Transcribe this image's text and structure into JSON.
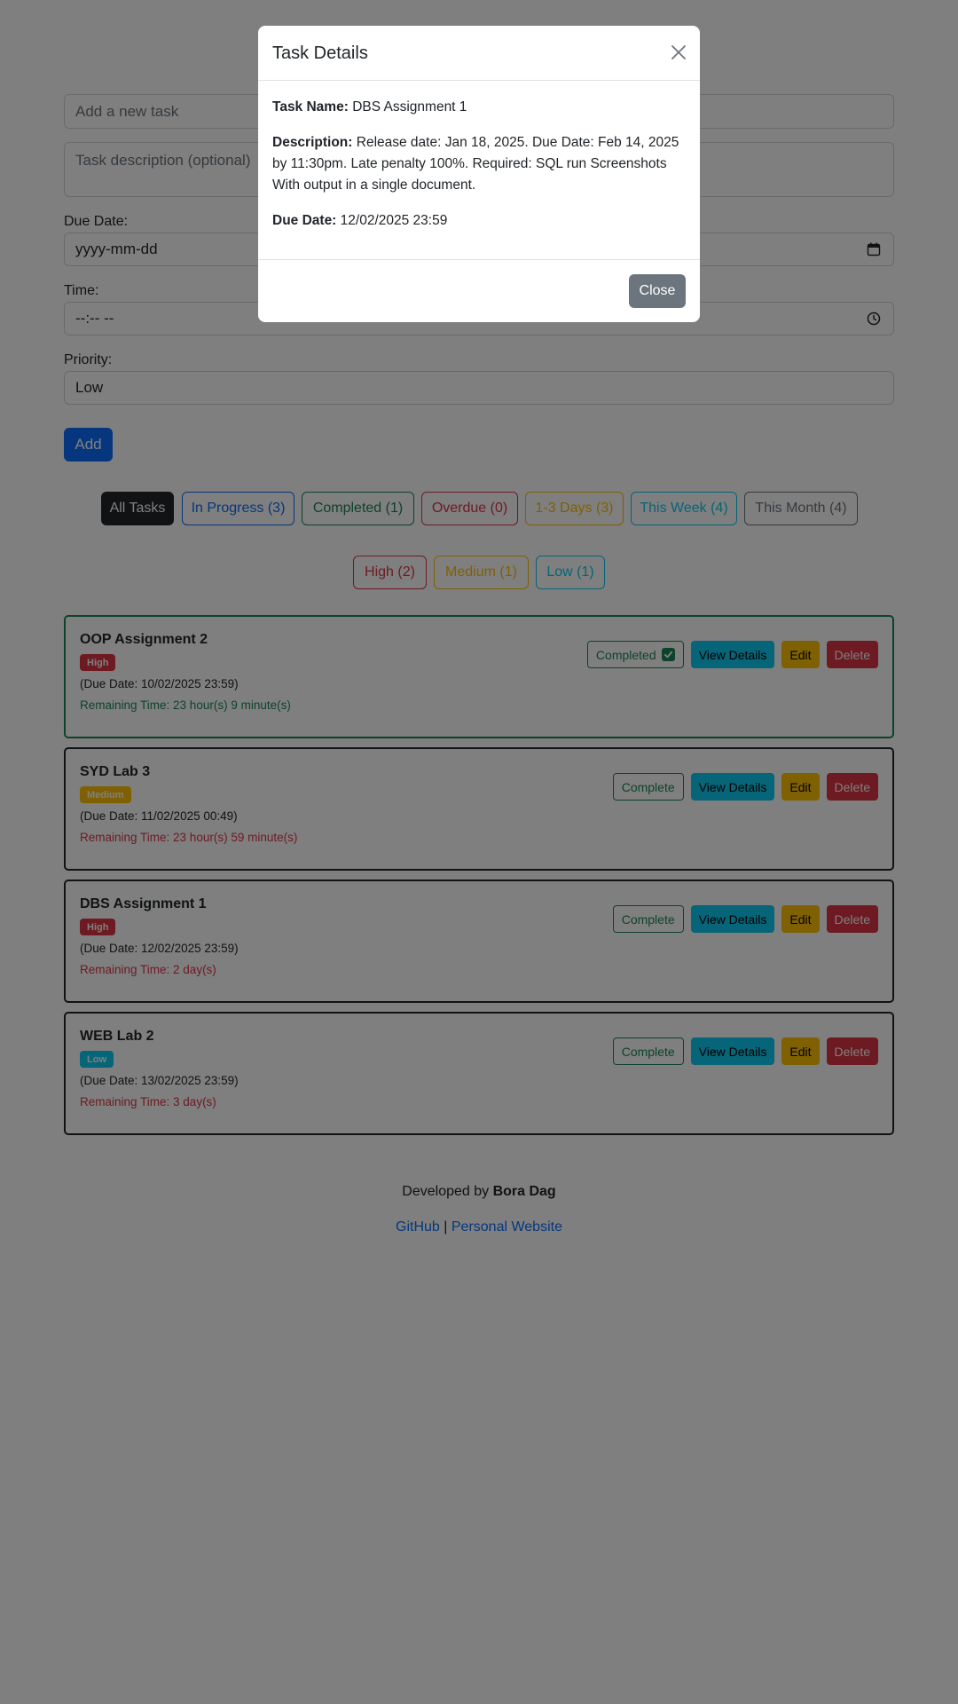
{
  "form": {
    "task_placeholder": "Add a new task",
    "description_placeholder": "Task description (optional)",
    "due_date_label": "Due Date:",
    "due_date_placeholder": "yyyy-mm-dd",
    "time_label": "Time:",
    "time_placeholder": "--:-- --",
    "priority_label": "Priority:",
    "priority_value": "Low",
    "add_label": "Add"
  },
  "filters": {
    "status": [
      {
        "label": "All Tasks",
        "color": "#212529",
        "active": true
      },
      {
        "label": "In Progress (3)",
        "color": "#0d6efd"
      },
      {
        "label": "Completed (1)",
        "color": "#198754"
      },
      {
        "label": "Overdue (0)",
        "color": "#dc3545"
      },
      {
        "label": "1-3 Days (3)",
        "color": "#ffc107"
      },
      {
        "label": "This Week (4)",
        "color": "#0dcaf0"
      },
      {
        "label": "This Month (4)",
        "color": "#6c757d"
      }
    ],
    "priority": [
      {
        "label": "High (2)",
        "color": "#dc3545"
      },
      {
        "label": "Medium (1)",
        "color": "#ffc107"
      },
      {
        "label": "Low (1)",
        "color": "#0dcaf0"
      }
    ]
  },
  "tasks": [
    {
      "title": "OOP Assignment 2",
      "priority": "High",
      "priority_color": "#dc3545",
      "due": "(Due Date: 10/02/2025 23:59)",
      "remaining": "Remaining Time: 23 hour(s) 9 minute(s)",
      "remaining_color": "#198754",
      "complete_label": "Completed",
      "completed": true
    },
    {
      "title": "SYD Lab 3",
      "priority": "Medium",
      "priority_color": "#ffc107",
      "due": "(Due Date: 11/02/2025 00:49)",
      "remaining": "Remaining Time: 23 hour(s) 59 minute(s)",
      "remaining_color": "#dc3545",
      "complete_label": "Complete",
      "completed": false
    },
    {
      "title": "DBS Assignment 1",
      "priority": "High",
      "priority_color": "#dc3545",
      "due": "(Due Date: 12/02/2025 23:59)",
      "remaining": "Remaining Time: 2 day(s)",
      "remaining_color": "#dc3545",
      "complete_label": "Complete",
      "completed": false
    },
    {
      "title": "WEB Lab 2",
      "priority": "Low",
      "priority_color": "#0dcaf0",
      "due": "(Due Date: 13/02/2025 23:59)",
      "remaining": "Remaining Time: 3 day(s)",
      "remaining_color": "#dc3545",
      "complete_label": "Complete",
      "completed": false
    }
  ],
  "task_actions": {
    "view": "View Details",
    "edit": "Edit",
    "delete": "Delete"
  },
  "footer": {
    "developed_by": "Developed by",
    "author": "Bora Dag",
    "github": "GitHub",
    "separator": "|",
    "website": "Personal Website"
  },
  "modal": {
    "title": "Task Details",
    "name_label": "Task Name:",
    "name_value": "DBS Assignment 1",
    "desc_label": "Description:",
    "desc_value": "Release date: Jan 18, 2025. Due Date: Feb 14, 2025 by 11:30pm. Late penalty 100%. Required: SQL run Screenshots With output in a single document.",
    "due_label": "Due Date:",
    "due_value": "12/02/2025 23:59",
    "close_label": "Close"
  }
}
